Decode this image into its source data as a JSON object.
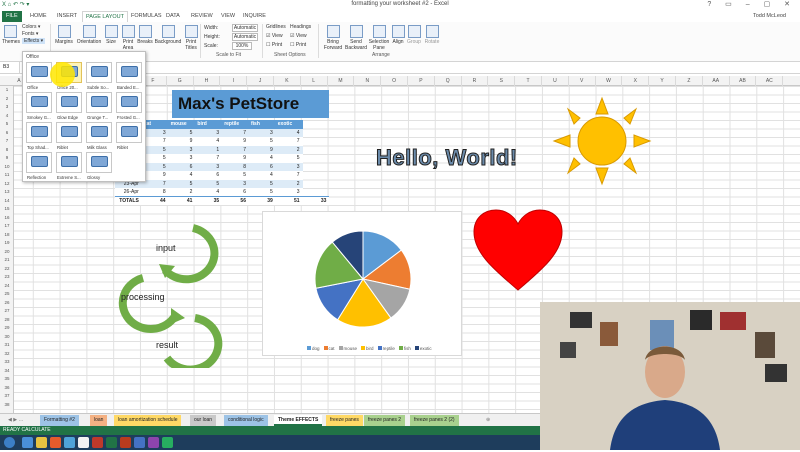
{
  "window": {
    "title": "formatting your worksheet #2 - Excel",
    "qat": "X ⌂ ↶ ↷ ▾",
    "controls": "? ▭ – ▢ ✕"
  },
  "tabs": [
    "FILE",
    "HOME",
    "INSERT",
    "PAGE LAYOUT",
    "FORMULAS",
    "DATA",
    "REVIEW",
    "VIEW",
    "INQUIRE"
  ],
  "active_tab": "PAGE LAYOUT",
  "user": "Todd McLeod",
  "ribbon": {
    "themes": "Themes",
    "colors": "Colors ▾",
    "fonts": "Fonts ▾",
    "effects": "Effects ▾",
    "margins": "Margins",
    "orientation": "Orientation",
    "size": "Size",
    "print_area": "Print Area",
    "breaks": "Breaks",
    "background": "Background",
    "print_titles": "Print Titles",
    "width_label": "Width:",
    "width_val": "Automatic",
    "height_label": "Height:",
    "height_val": "Automatic",
    "scale_label": "Scale:",
    "scale_val": "100%",
    "scale_group": "Scale to Fit",
    "gridlines": "Gridlines",
    "headings": "Headings",
    "view1": "View",
    "view2": "View",
    "print1": "Print",
    "print2": "Print",
    "sheet_options": "Sheet Options",
    "bring_forward": "Bring Forward",
    "send_backward": "Send Backward",
    "selection_pane": "Selection Pane",
    "align": "Align",
    "group": "Group",
    "rotate": "Rotate",
    "arrange": "Arrange"
  },
  "namebox": "B3",
  "columns": [
    "A",
    "B",
    "C",
    "D",
    "E",
    "F",
    "G",
    "H",
    "I",
    "J",
    "K",
    "L",
    "M",
    "N",
    "O",
    "P",
    "Q",
    "R",
    "S",
    "T",
    "U",
    "V",
    "W",
    "X",
    "Y",
    "Z",
    "AA",
    "AB",
    "AC"
  ],
  "rows": [
    "1",
    "2",
    "3",
    "4",
    "5",
    "6",
    "7",
    "8",
    "9",
    "10",
    "11",
    "12",
    "13",
    "14",
    "15",
    "16",
    "17",
    "18",
    "19",
    "20",
    "21",
    "22",
    "23",
    "24",
    "25",
    "26",
    "27",
    "28",
    "29",
    "30",
    "31",
    "32",
    "33",
    "34",
    "35",
    "36",
    "37",
    "38"
  ],
  "store_title": "Max's PetStore",
  "table": {
    "headers": [
      "",
      "cat",
      "mouse",
      "bird",
      "reptile",
      "fish",
      "exotic"
    ],
    "rows": [
      [
        "",
        "3",
        "5",
        "3",
        "7",
        "3",
        "4"
      ],
      [
        "",
        "7",
        "9",
        "4",
        "9",
        "5",
        "7"
      ],
      [
        "",
        "5",
        "3",
        "1",
        "7",
        "9",
        "2"
      ],
      [
        "",
        "5",
        "3",
        "7",
        "9",
        "4",
        "5"
      ],
      [
        "",
        "5",
        "6",
        "3",
        "8",
        "6",
        "3"
      ],
      [
        "",
        "9",
        "4",
        "6",
        "5",
        "4",
        "7"
      ],
      [
        "23-Apr",
        "7",
        "5",
        "5",
        "3",
        "5",
        "2"
      ],
      [
        "26-Apr",
        "8",
        "2",
        "4",
        "6",
        "5",
        "3"
      ]
    ],
    "totals": [
      "TOTALS",
      "44",
      "41",
      "35",
      "56",
      "39",
      "51",
      "33"
    ]
  },
  "hello": "Hello, World!",
  "cycle": {
    "input": "input",
    "processing": "processing",
    "result": "result"
  },
  "gallery": {
    "header": "Office",
    "items": [
      "Office",
      "Office 20...",
      "Subtle So...",
      "Banded E...",
      "Smokey G...",
      "Glow Edge",
      "Grunge T...",
      "Frosted G...",
      "Top Shad...",
      "Riblet",
      "Milk Glass",
      "Riblet",
      "Reflection",
      "Extreme S...",
      "Glossy"
    ]
  },
  "pie": {
    "legend": [
      "dog",
      "cat",
      "mouse",
      "bird",
      "reptile",
      "fish",
      "exotic"
    ],
    "colors": [
      "#5b9bd5",
      "#ed7d31",
      "#a5a5a5",
      "#ffc000",
      "#4472c4",
      "#70ad47",
      "#264478"
    ],
    "values": [
      44,
      41,
      35,
      56,
      39,
      51,
      33
    ]
  },
  "sheet_tabs": [
    {
      "label": "Formatting #2",
      "color": "#9dc3e6"
    },
    {
      "label": "loan",
      "color": "#f4b183"
    },
    {
      "label": "loan amortization schedule",
      "color": "#ffd966"
    },
    {
      "label": "our loan",
      "color": "#c9c9c9"
    },
    {
      "label": "conditional logic",
      "color": "#9dc3e6"
    },
    {
      "label": "Theme EFFECTS",
      "color": "#ffffff"
    },
    {
      "label": "freeze panes",
      "color": "#ffd966"
    },
    {
      "label": "freeze panes 2",
      "color": "#a9d18e"
    },
    {
      "label": "freeze panes 2 (2)",
      "color": "#a9d18e"
    }
  ],
  "status": "READY   CALCULATE"
}
